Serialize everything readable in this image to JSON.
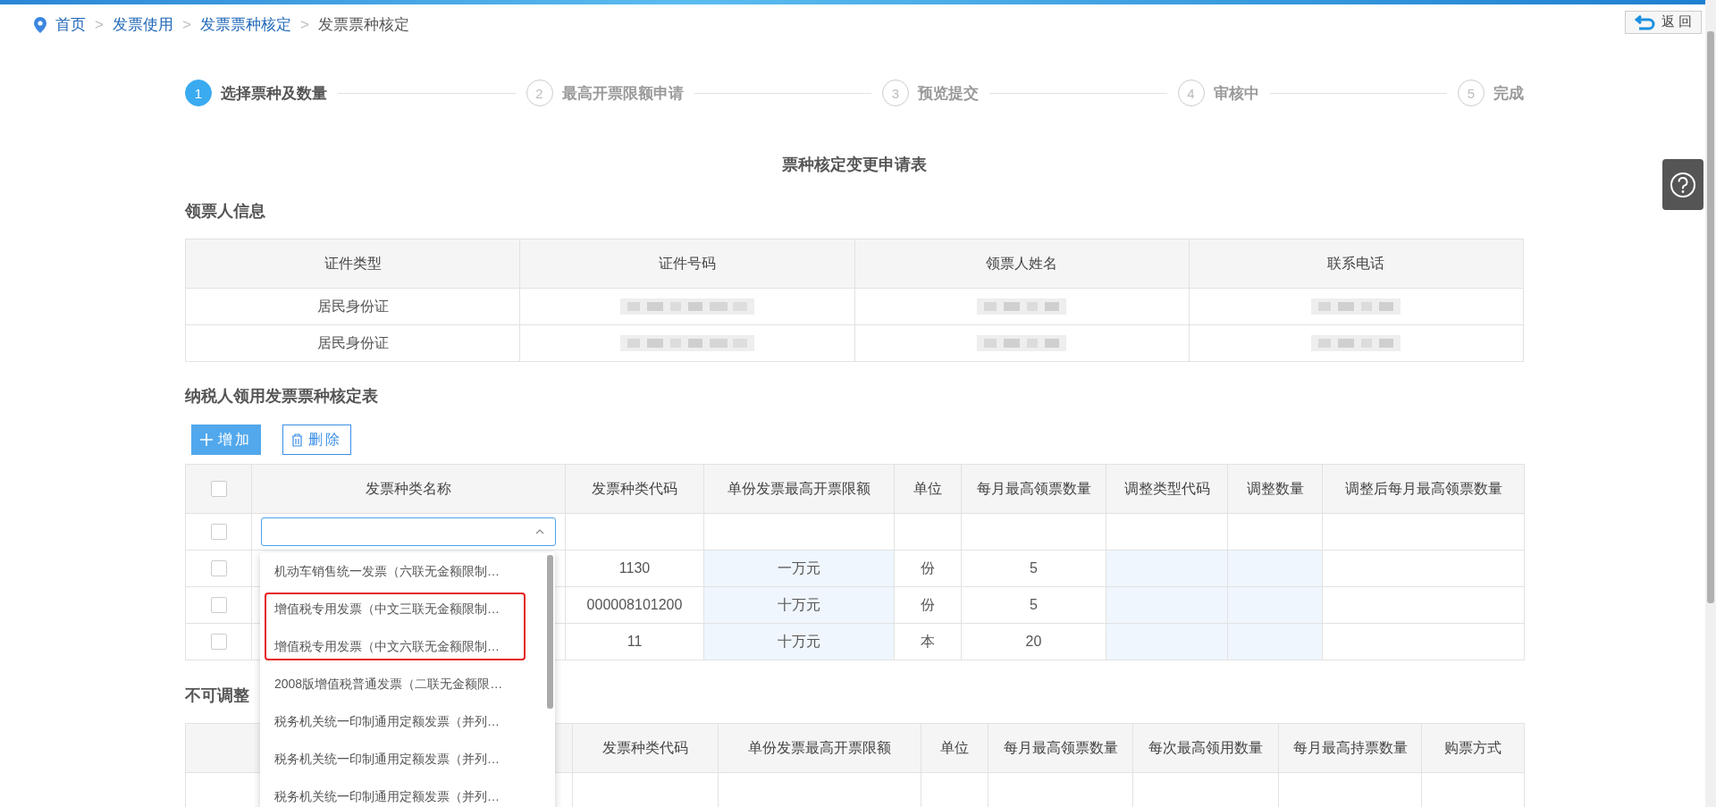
{
  "breadcrumb": {
    "separator": ">",
    "items": [
      {
        "label": "首页",
        "link": true
      },
      {
        "label": "发票使用",
        "link": true
      },
      {
        "label": "发票票种核定",
        "link": true
      },
      {
        "label": "发票票种核定",
        "link": false
      }
    ]
  },
  "back_button": {
    "label": "返 回"
  },
  "steps": [
    {
      "number": "1",
      "label": "选择票种及数量",
      "selected": true
    },
    {
      "number": "2",
      "label": "最高开票限额申请",
      "selected": false
    },
    {
      "number": "3",
      "label": "预览提交",
      "selected": false
    },
    {
      "number": "4",
      "label": "审核中",
      "selected": false
    },
    {
      "number": "5",
      "label": "完成",
      "selected": false
    }
  ],
  "form_title": "票种核定变更申请表",
  "recipient_section": {
    "title": "领票人信息",
    "columns": [
      "证件类型",
      "证件号码",
      "领票人姓名",
      "联系电话"
    ],
    "rows": [
      {
        "cells": [
          {
            "kind": "text",
            "text": "居民身份证"
          },
          {
            "kind": "blurred"
          },
          {
            "kind": "blurred"
          },
          {
            "kind": "blurred"
          }
        ]
      },
      {
        "cells": [
          {
            "kind": "text",
            "text": "居民身份证"
          },
          {
            "kind": "blurred"
          },
          {
            "kind": "blurred"
          },
          {
            "kind": "blurred"
          }
        ]
      }
    ]
  },
  "invoice_section": {
    "title": "纳税人领用发票票种核定表",
    "add_button": "增加",
    "delete_button": "删除",
    "header_checked": false,
    "columns": [
      "发票种类名称",
      "发票种类代码",
      "单份发票最高开票限额",
      "单位",
      "每月最高领票数量",
      "调整类型代码",
      "调整数量",
      "调整后每月最高领票数量"
    ],
    "rows": [
      {
        "kind": "select",
        "checked": false
      },
      {
        "kind": "data",
        "checked": false,
        "code": "1130",
        "limit": "一万元",
        "unit": "份",
        "monthly": "5"
      },
      {
        "kind": "data",
        "checked": false,
        "code": "000008101200",
        "limit": "十万元",
        "unit": "份",
        "monthly": "5"
      },
      {
        "kind": "data",
        "checked": false,
        "code": "11",
        "limit": "十万元",
        "unit": "本",
        "monthly": "20"
      }
    ]
  },
  "dropdown_options": [
    {
      "label": "机动车销售统一发票（六联无金额限制…",
      "highlighted": false
    },
    {
      "label": "增值税专用发票（中文三联无金额限制…",
      "highlighted": true
    },
    {
      "label": "增值税专用发票（中文六联无金额限制…",
      "highlighted": true
    },
    {
      "label": "2008版增值税普通发票（二联无金额限…",
      "highlighted": false
    },
    {
      "label": "税务机关统一印制通用定额发票（并列…",
      "highlighted": false
    },
    {
      "label": "税务机关统一印制通用定额发票（并列…",
      "highlighted": false
    },
    {
      "label": "税务机关统一印制通用定额发票（并列…",
      "highlighted": false
    }
  ],
  "fixed_section": {
    "title": "不可调整",
    "columns": [
      "发票种类代码",
      "单份发票最高开票限额",
      "单位",
      "每月最高领票数量",
      "每次最高领用数量",
      "每月最高持票数量",
      "购票方式"
    ]
  }
}
